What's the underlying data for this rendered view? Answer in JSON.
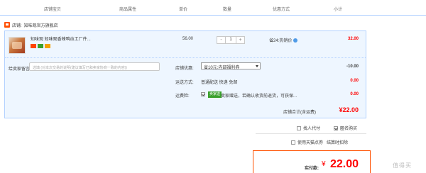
{
  "columns": {
    "shop_item": "店铺宝贝",
    "attributes": "商品属性",
    "unit_price": "单价",
    "quantity": "数量",
    "discount": "优惠方式",
    "subtotal": "小计"
  },
  "shop": {
    "label": "店铺:",
    "name": "知味观官方旗舰店"
  },
  "item": {
    "title": "知味观 知味观香辣鸭血工厂件...",
    "unit_price": "56.00",
    "qty_minus": "-",
    "quantity": "1",
    "qty_plus": "+",
    "discount_text": "省24:热销价",
    "subtotal": "32.00"
  },
  "message": {
    "label": "给卖家留言:",
    "placeholder": "选填 (对本次交易的说明(建议填写已和卖家协商一致的内容))"
  },
  "coupon": {
    "label": "店铺优惠:",
    "selected": "省10元:内部福利券",
    "value": "-10.00",
    "value_color": "#3c3c3c"
  },
  "shipping": {
    "label": "运送方式:",
    "text": "普通配送 快递 免邮",
    "value": "0.00",
    "value_color": "#ff0000"
  },
  "insurance": {
    "label": "运费险:",
    "badge": "卖家送",
    "text": "卖家赠送，若确认收货前退货，可获保...",
    "value": "0.00",
    "value_color": "#ff0000"
  },
  "shop_total": {
    "label": "店铺合计(含运费)",
    "value": "¥22.00"
  },
  "options": {
    "proxy_pay": "找人代付",
    "anonymous": "匿名购买",
    "anonymous_checked": true,
    "proxy_checked": false,
    "tmall_points": "使用天猫点券",
    "settle_link": "结算时扣除"
  },
  "pay": {
    "label": "实付款:",
    "currency": "¥",
    "value": "22.00"
  },
  "watermark": "值得买"
}
